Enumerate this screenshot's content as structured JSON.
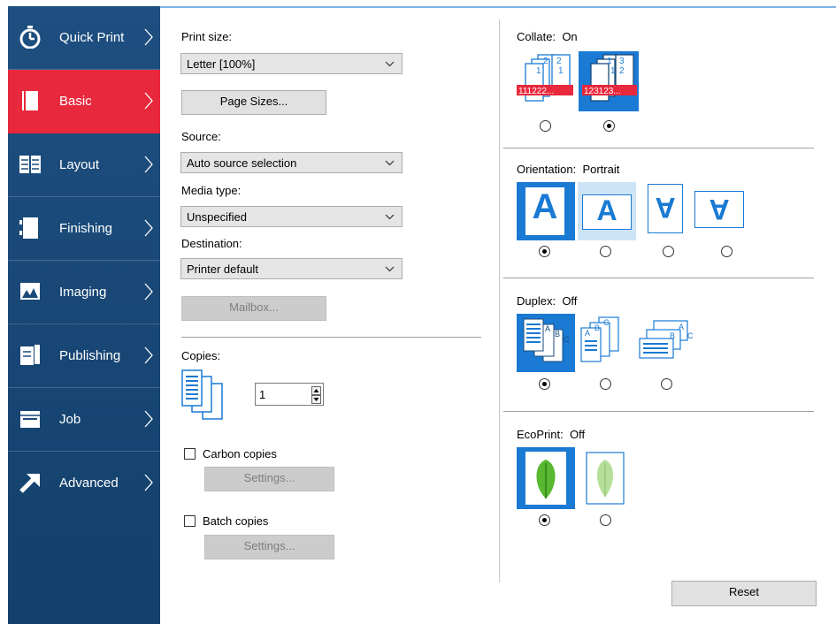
{
  "sidebar": {
    "items": [
      {
        "label": "Quick Print",
        "icon": "stopwatch-icon",
        "active": false
      },
      {
        "label": "Basic",
        "icon": "page-icon",
        "active": true
      },
      {
        "label": "Layout",
        "icon": "layout-icon",
        "active": false
      },
      {
        "label": "Finishing",
        "icon": "finishing-icon",
        "active": false
      },
      {
        "label": "Imaging",
        "icon": "imaging-icon",
        "active": false
      },
      {
        "label": "Publishing",
        "icon": "publishing-icon",
        "active": false
      },
      {
        "label": "Job",
        "icon": "job-icon",
        "active": false
      },
      {
        "label": "Advanced",
        "icon": "arrow-icon",
        "active": false
      }
    ]
  },
  "basic": {
    "print_size_label": "Print size:",
    "print_size_value": "Letter  [100%]",
    "page_sizes_button": "Page Sizes...",
    "source_label": "Source:",
    "source_value": "Auto source selection",
    "media_type_label": "Media type:",
    "media_type_value": "Unspecified",
    "destination_label": "Destination:",
    "destination_value": "Printer default",
    "mailbox_button": "Mailbox...",
    "copies_label": "Copies:",
    "copies_value": "1",
    "carbon_copies_label": "Carbon copies",
    "carbon_settings_button": "Settings...",
    "batch_copies_label": "Batch copies",
    "batch_settings_button": "Settings..."
  },
  "collate": {
    "label": "Collate:",
    "value": "On",
    "off_icon_text": "111222...",
    "on_icon_text": "123123..."
  },
  "orientation": {
    "label": "Orientation:",
    "value": "Portrait",
    "glyph": "A"
  },
  "duplex": {
    "label": "Duplex:",
    "value": "Off"
  },
  "ecoprint": {
    "label": "EcoPrint:",
    "value": "Off"
  },
  "reset_button": "Reset",
  "colors": {
    "sidebar_bg": "#1a4a7a",
    "active_red": "#e8283c",
    "selected_blue": "#1a7ad4",
    "hover_blue": "#cde4f7"
  }
}
